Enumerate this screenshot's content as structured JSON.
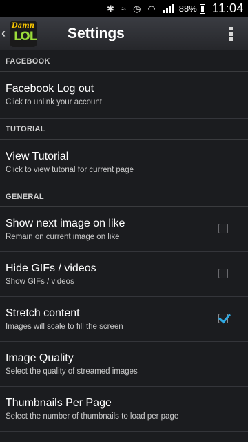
{
  "status_bar": {
    "battery_pct": "88%",
    "time": "11:04",
    "icons": [
      "bluetooth-icon",
      "vibrate-icon",
      "alarm-icon",
      "wifi-icon",
      "signal-icon",
      "battery-icon"
    ]
  },
  "action_bar": {
    "logo_line1": "Damn",
    "logo_line2": "LOL",
    "title": "Settings"
  },
  "sections": {
    "facebook": {
      "header": "FACEBOOK",
      "items": [
        {
          "title": "Facebook Log out",
          "summary": "Click to unlink your account"
        }
      ]
    },
    "tutorial": {
      "header": "TUTORIAL",
      "items": [
        {
          "title": "View Tutorial",
          "summary": "Click to view tutorial for current page"
        }
      ]
    },
    "general": {
      "header": "GENERAL",
      "items": [
        {
          "title": "Show next image on like",
          "summary": "Remain on current image on like",
          "checked": false
        },
        {
          "title": "Hide GIFs / videos",
          "summary": "Show GIFs / videos",
          "checked": false
        },
        {
          "title": "Stretch content",
          "summary": "Images will scale to fill the screen",
          "checked": true
        },
        {
          "title": "Image Quality",
          "summary": "Select the quality of streamed images"
        },
        {
          "title": "Thumbnails Per Page",
          "summary": "Select the number of thumbnails to load per page"
        }
      ]
    }
  },
  "colors": {
    "background": "#1b1c1f",
    "accent_check": "#2fa9e2",
    "logo_yellow": "#f6c400",
    "logo_green": "#9bdc3a"
  }
}
